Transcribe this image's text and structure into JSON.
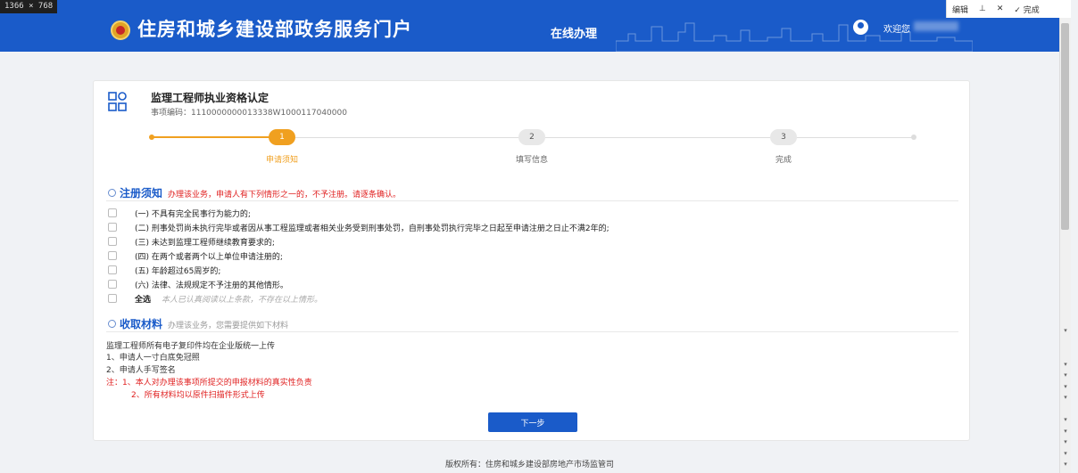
{
  "screen_tag": "1366 × 768",
  "header": {
    "portal_title": "住房和城乡建设部政务服务门户",
    "nav_online": "在线办理",
    "welcome": "欢迎您"
  },
  "toolbar": {
    "edit": "编辑",
    "upload": "⊥",
    "close": "✕",
    "done": "✓ 完成"
  },
  "service": {
    "title": "监理工程师执业资格认定",
    "code": "事项编码：1110000000013338W1000117040000"
  },
  "steps": [
    {
      "number": "1",
      "label": "申请须知"
    },
    {
      "number": "2",
      "label": "填写信息"
    },
    {
      "number": "3",
      "label": "完成"
    }
  ],
  "notice": {
    "title": "注册须知",
    "note": "办理该业务，申请人有下列情形之一的，不予注册。请逐条确认。",
    "note_color": "#e02020",
    "conditions": [
      "(一) 不具有完全民事行为能力的;",
      "(二) 刑事处罚尚未执行完毕或者因从事工程监理或者相关业务受到刑事处罚，自刑事处罚执行完毕之日起至申请注册之日止不满2年的;",
      "(三) 未达到监理工程师继续教育要求的;",
      "(四) 在两个或者两个以上单位申请注册的;",
      "(五) 年龄超过65周岁的;",
      "(六) 法律、法规规定不予注册的其他情形。"
    ],
    "select_all_label": "全选",
    "select_all_note": "本人已认真阅读以上条款，不存在以上情形。"
  },
  "materials": {
    "title": "收取材料",
    "note": "办理该业务，您需要提供如下材料",
    "lines": [
      "监理工程师所有电子复印件均在企业版统一上传",
      "1、申请人一寸白底免冠照",
      "2、申请人手写签名"
    ],
    "remarks": [
      "注：1、本人对办理该事项所提交的申报材料的真实性负责",
      "2、所有材料均以原件扫描件形式上传"
    ]
  },
  "next_button": "下一步",
  "footer": "版权所有：住房和城乡建设部房地产市场监管司",
  "colors": {
    "brand": "#1a5bc9",
    "step_active": "#f0a020",
    "warning": "#e02020"
  }
}
